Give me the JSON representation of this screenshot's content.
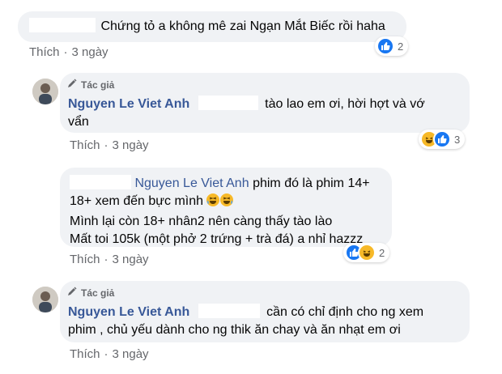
{
  "comments": [
    {
      "text": "Chứng tỏ a không mê zai Ngạn Mắt Biếc rồi haha",
      "like_label": "Thích",
      "time": "3 ngày",
      "reaction_count": "2"
    },
    {
      "author_badge": "Tác giả",
      "name": "Nguyen Le Viet Anh",
      "text_line1": "tào lao em ơi, hời hợt và vớ",
      "text_line2": "vẩn",
      "like_label": "Thích",
      "time": "3 ngày",
      "reaction_count": "3"
    },
    {
      "name": "Nguyen Le Viet Anh",
      "text_line1": "phim đó là phim 14+",
      "text_line2": "18+ xem đến bực mình",
      "text_line3": "Mình lại còn 18+ nhân2 nên càng thấy tào lào",
      "text_line4": "Mất toi 105k (một phở 2 trứng + trà đá) a nhỉ hazzz",
      "like_label": "Thích",
      "time": "3 ngày",
      "reaction_count": "2"
    },
    {
      "author_badge": "Tác giả",
      "name": "Nguyen Le Viet Anh",
      "text_line1": "cần có chỉ định cho ng xem",
      "text_line2": "phim , chủ yếu dành cho ng thik ăn chay và ăn nhạt em ơi",
      "like_label": "Thích",
      "time": "3 ngày"
    }
  ],
  "separator": "·",
  "colors": {
    "like_blue": "#1877f2",
    "haha_yellow": "#f7b928",
    "name_blue": "#385898",
    "bubble": "#f0f2f5"
  },
  "icons": [
    "like-icon",
    "haha-icon",
    "pencil-icon",
    "laughing-emoji-icon"
  ]
}
